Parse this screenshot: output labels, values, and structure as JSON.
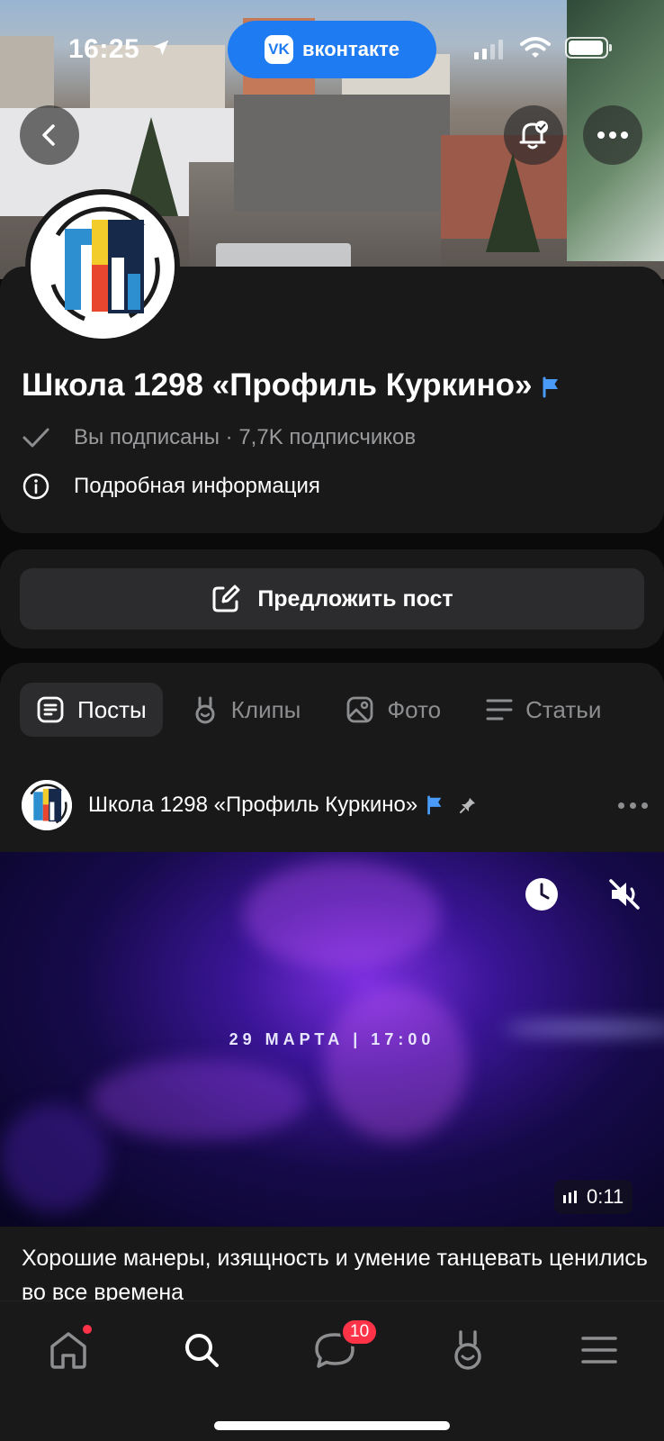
{
  "status_bar": {
    "time": "16:25",
    "vk_pill_text": "вконтакте",
    "vk_logo": "VK"
  },
  "cover": {
    "back_icon": "chevron-left-icon",
    "bell_icon": "bell-check-icon",
    "more_icon": "more-horizontal-icon"
  },
  "group": {
    "title": "Школа 1298 «Профиль Куркино»",
    "subscribed_text": "Вы подписаны · 7,7K подписчиков",
    "details_text": "Подробная информация",
    "suggest_post": "Предложить пост"
  },
  "tabs": [
    {
      "label": "Посты",
      "icon": "posts-icon",
      "active": true
    },
    {
      "label": "Клипы",
      "icon": "clips-icon",
      "active": false
    },
    {
      "label": "Фото",
      "icon": "photo-icon",
      "active": false
    },
    {
      "label": "Статьи",
      "icon": "articles-icon",
      "active": false
    }
  ],
  "post": {
    "author": "Школа 1298 «Профиль Куркино»",
    "video_date": "29 МАРТА | 17:00",
    "duration": "0:11",
    "text": "Хорошие манеры, изящность и умение танцевать ценились во все времена"
  },
  "bottom_nav": {
    "messages_badge": "10",
    "items": [
      "home-icon",
      "search-icon",
      "messages-icon",
      "clips-icon",
      "menu-icon"
    ]
  },
  "colors": {
    "accent": "#1f7bf2",
    "background": "#0a0a0a",
    "card": "#19191a",
    "badge": "#ff3347"
  }
}
